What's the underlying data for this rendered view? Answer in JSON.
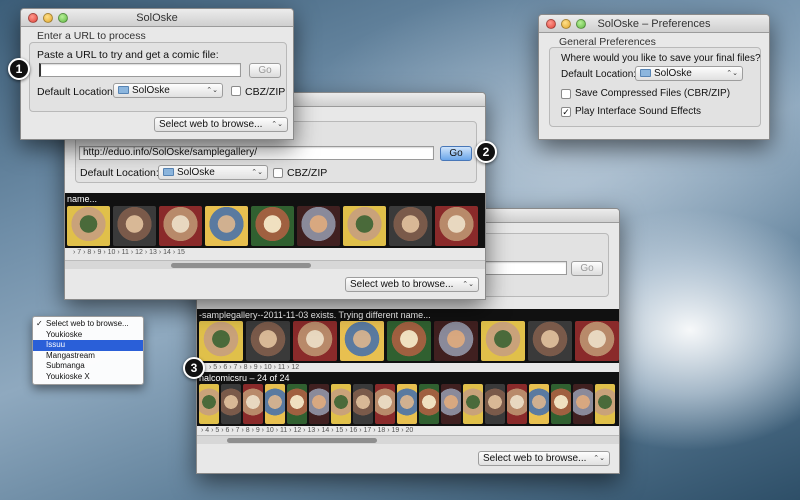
{
  "window1": {
    "title": "SolOske",
    "group_title": "Enter a URL to process",
    "prompt": "Paste a URL to try and get a comic file:",
    "url_value": "",
    "go_label": "Go",
    "location_label": "Default Location:",
    "location_value": "SolOske",
    "cbz_label": "CBZ/ZIP",
    "browse_value": "Select web to browse..."
  },
  "window2": {
    "url_value": "http://eduo.info/SolOske/samplegallery/",
    "go_label": "Go",
    "location_label": "Default Location:",
    "location_value": "SolOske",
    "cbz_label": "CBZ/ZIP",
    "strip_caption": "name...",
    "tick_labels": "› 7     › 8     › 9     › 10     › 11     › 12     › 13     › 14     › 15",
    "browse_value": "Select web to browse..."
  },
  "window3": {
    "go_label": "Go",
    "strip1_caption": "-samplegallery--2011-11-03 exists. Trying different name...",
    "strip1_ticks": "›  5     ›  6     ›  7     ›  8     ›  9     ›  10     ›  11     ›  12",
    "strip2_caption": "nalcomicsru – 24 of 24",
    "strip2_ticks": "› 4  › 5  › 6  › 7  › 8  › 9  › 10  › 11  › 12  › 13  › 14  › 15  › 16  › 17  › 18  › 19  › 20",
    "browse_value": "Select web to browse..."
  },
  "prefs": {
    "title": "SolOske – Preferences",
    "group_title": "General Preferences",
    "question": "Where would you like to save your final files?",
    "location_label": "Default Location:",
    "location_value": "SolOske",
    "save_compressed_label": "Save Compressed Files (CBR/ZIP)",
    "save_compressed_checked": false,
    "play_sounds_label": "Play Interface Sound Effects",
    "play_sounds_checked": true
  },
  "browse_menu": {
    "items": [
      "Select web to browse...",
      "Youkioske",
      "Issuu",
      "Mangastream",
      "Submanga",
      "Youkioske X"
    ],
    "checked_index": 0,
    "highlighted_index": 2
  },
  "badges": [
    "1",
    "2",
    "3"
  ],
  "icons": {
    "folder": "folder-icon",
    "popup_arrows": "⌃⌄",
    "check": "✓"
  },
  "colors": {
    "accent_blue": "#2a5fd8",
    "go_button_blue": "#6aa6ea"
  }
}
